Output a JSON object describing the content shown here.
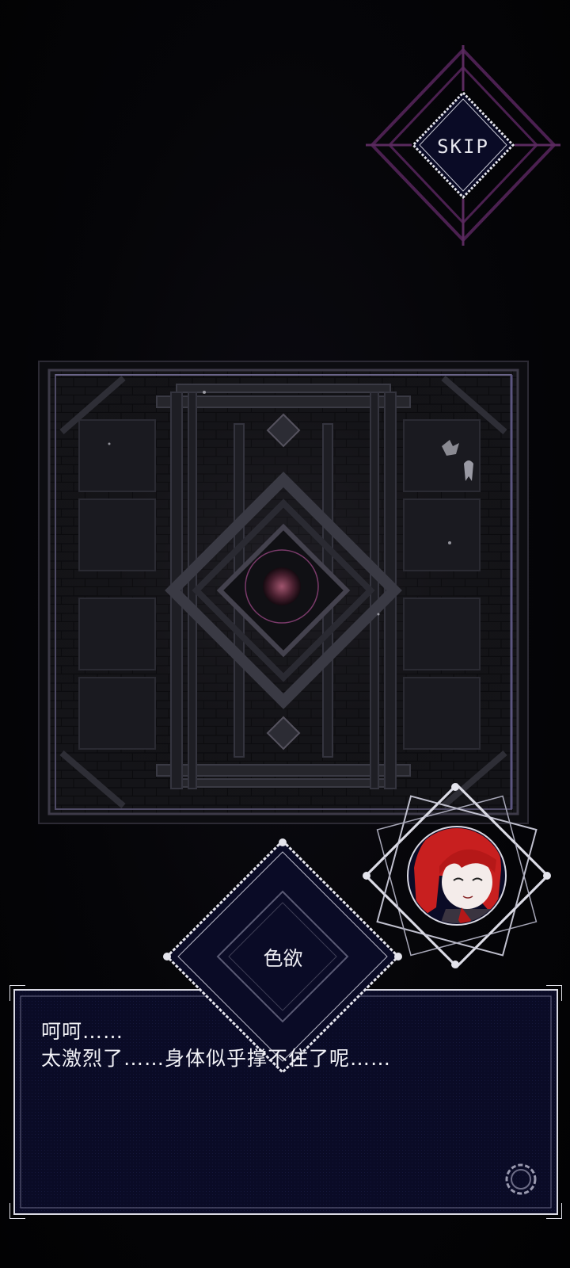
{
  "skip": {
    "label": "SKIP"
  },
  "speaker": {
    "name": "色欲"
  },
  "dialogue": {
    "lines": [
      "呵呵……",
      "太激烈了……身体似乎撑不住了呢……"
    ]
  },
  "icons": {
    "advance": "gear-ring-icon",
    "portrait": "red-haired-character-portrait"
  },
  "colors": {
    "skip_frame": "#5a2a5e",
    "panel_bg": "#0a0b26",
    "panel_border": "#d9d9e3",
    "hair": "#c81f1f",
    "orb": "#b05a78"
  }
}
